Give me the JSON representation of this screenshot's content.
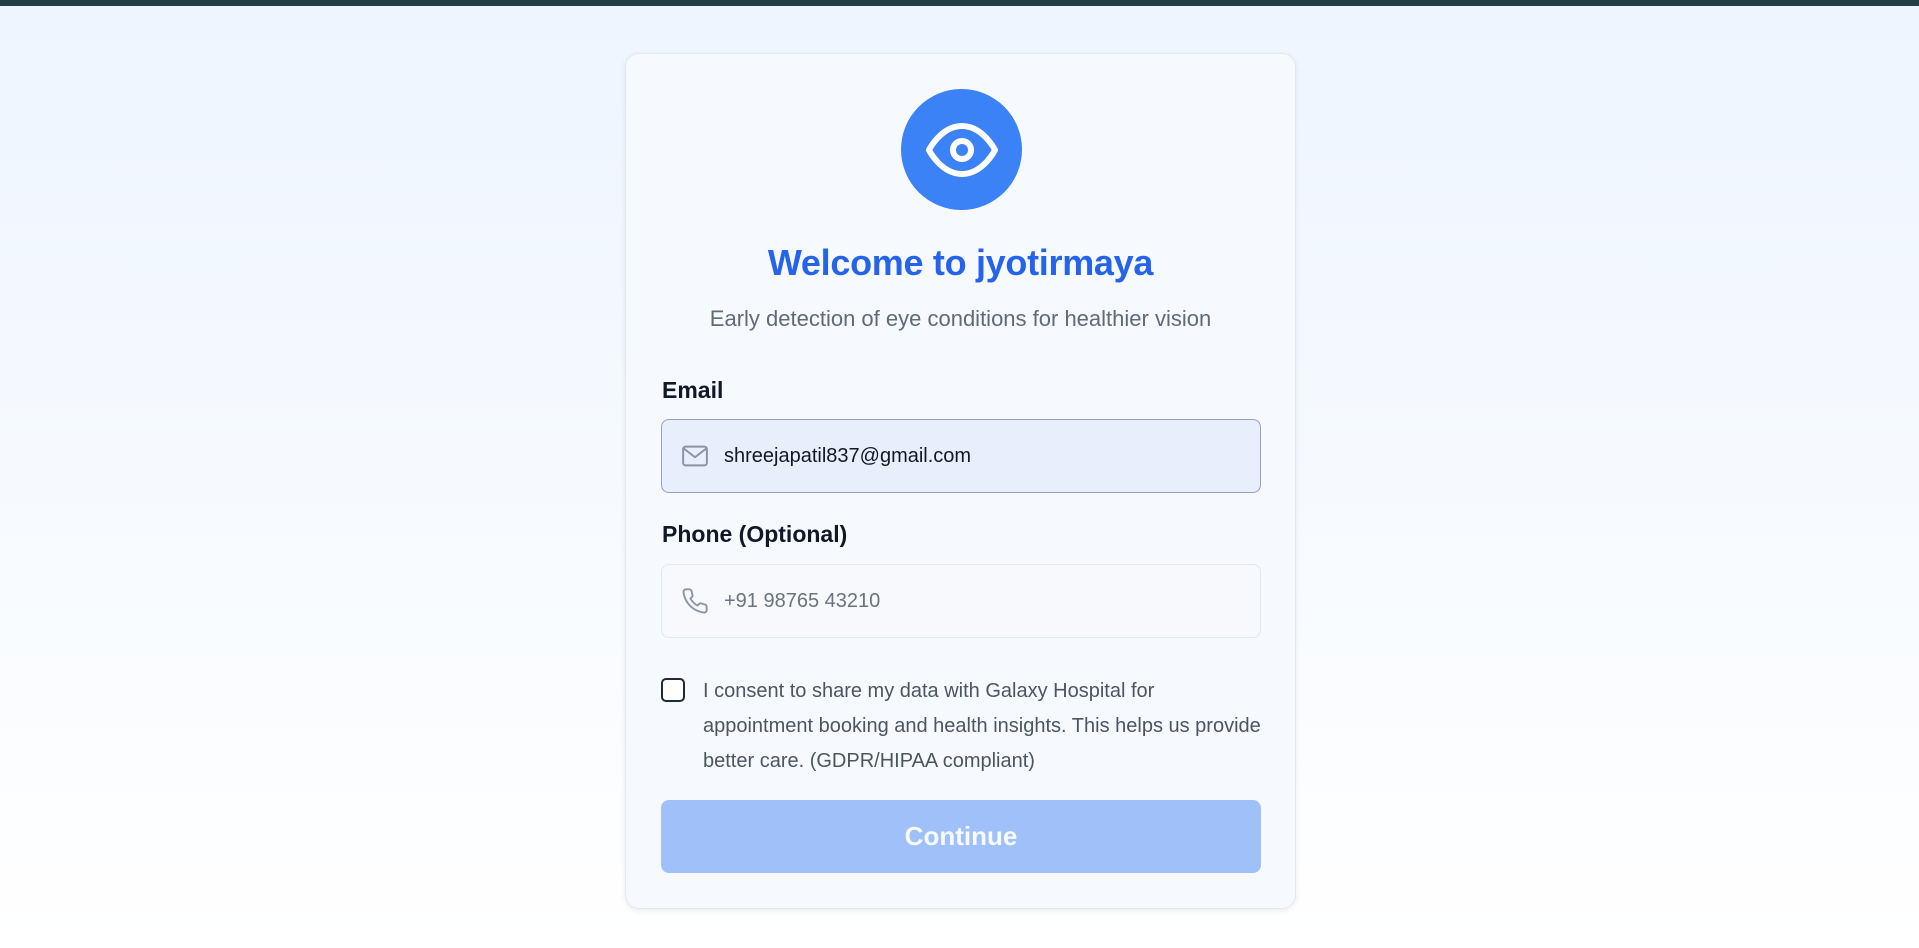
{
  "app": {
    "title": "Welcome to jyotirmaya",
    "subtitle": "Early detection of eye conditions for healthier vision",
    "logo_icon": "eye-icon"
  },
  "form": {
    "email": {
      "label": "Email",
      "value": "shreejapatil837@gmail.com",
      "icon": "mail-icon"
    },
    "phone": {
      "label": "Phone (Optional)",
      "placeholder": "+91 98765 43210",
      "value": "",
      "icon": "phone-icon"
    },
    "consent": {
      "checked": false,
      "text": "I consent to share my data with Galaxy Hospital for appointment booking and health insights. This helps us provide better care. (GDPR/HIPAA compliant)"
    },
    "submit_label": "Continue",
    "submit_enabled": false
  },
  "colors": {
    "accent": "#3b82f6",
    "title": "#2563eb",
    "button_disabled": "#9fc0f8",
    "top_strip": "#243d47"
  }
}
